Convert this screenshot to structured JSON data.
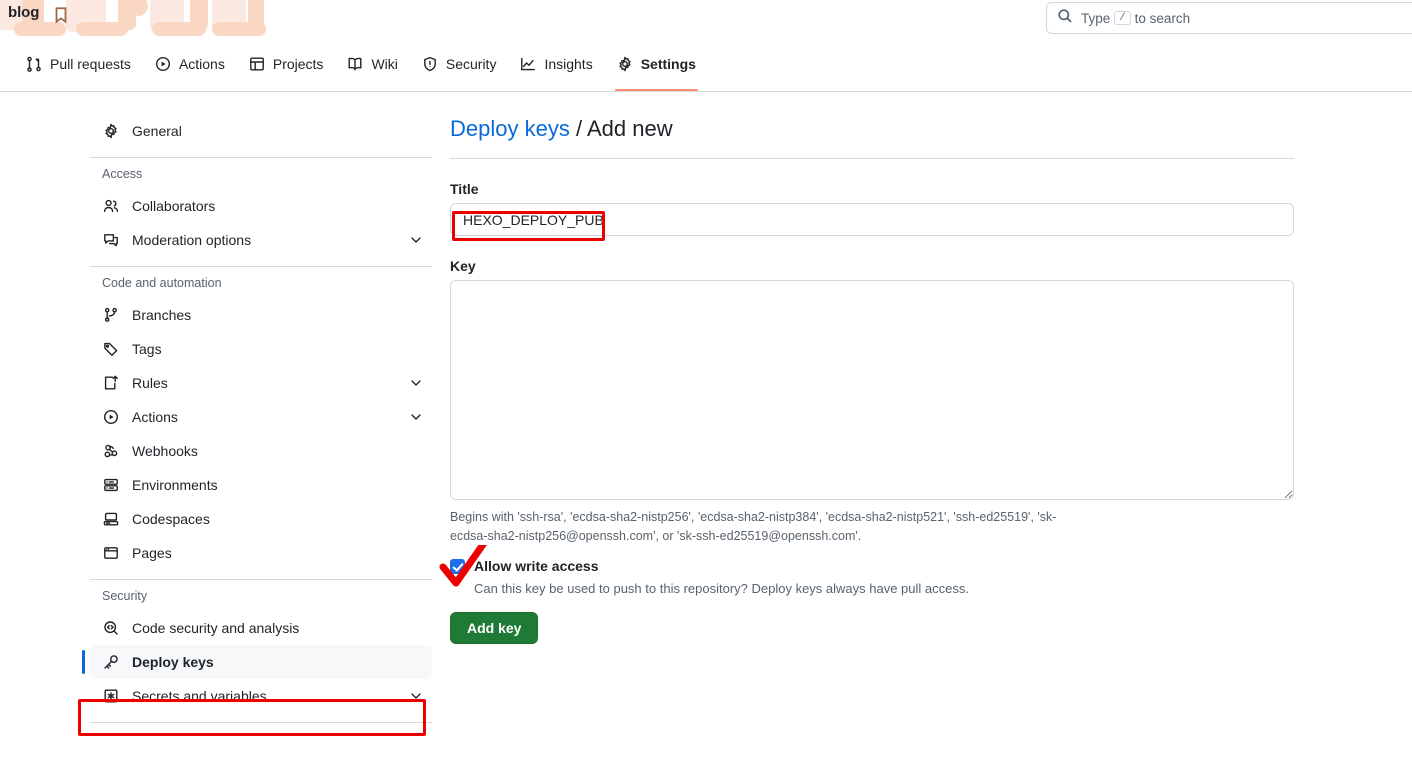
{
  "topbar": {
    "repo_name": "blog",
    "bookmark_icon": "bookmark-icon",
    "search_placeholder_prefix": "Type",
    "search_slash_key": "/",
    "search_placeholder_suffix": "to search",
    "search_icon": "search-icon"
  },
  "repo_nav": {
    "items": [
      {
        "label": "Pull requests",
        "icon": "git-pull-request-icon",
        "active": false
      },
      {
        "label": "Actions",
        "icon": "play-circle-icon",
        "active": false
      },
      {
        "label": "Projects",
        "icon": "table-icon",
        "active": false
      },
      {
        "label": "Wiki",
        "icon": "book-icon",
        "active": false
      },
      {
        "label": "Security",
        "icon": "shield-alert-icon",
        "active": false
      },
      {
        "label": "Insights",
        "icon": "graph-icon",
        "active": false
      },
      {
        "label": "Settings",
        "icon": "gear-icon",
        "active": true
      }
    ],
    "active_underline_color": "#fd8c73"
  },
  "sidebar": {
    "top_items": [
      {
        "label": "General",
        "icon": "gear-icon",
        "chevron": false,
        "selected": false
      }
    ],
    "groups": [
      {
        "title": "Access",
        "items": [
          {
            "label": "Collaborators",
            "icon": "people-icon",
            "chevron": false,
            "selected": false
          },
          {
            "label": "Moderation options",
            "icon": "comment-discussion-icon",
            "chevron": true,
            "selected": false
          }
        ]
      },
      {
        "title": "Code and automation",
        "items": [
          {
            "label": "Branches",
            "icon": "git-branch-icon",
            "chevron": false,
            "selected": false
          },
          {
            "label": "Tags",
            "icon": "tag-icon",
            "chevron": false,
            "selected": false
          },
          {
            "label": "Rules",
            "icon": "rules-icon",
            "chevron": true,
            "selected": false
          },
          {
            "label": "Actions",
            "icon": "play-circle-icon",
            "chevron": true,
            "selected": false
          },
          {
            "label": "Webhooks",
            "icon": "webhook-icon",
            "chevron": false,
            "selected": false
          },
          {
            "label": "Environments",
            "icon": "server-icon",
            "chevron": false,
            "selected": false
          },
          {
            "label": "Codespaces",
            "icon": "codespaces-icon",
            "chevron": false,
            "selected": false
          },
          {
            "label": "Pages",
            "icon": "browser-icon",
            "chevron": false,
            "selected": false
          }
        ]
      },
      {
        "title": "Security",
        "items": [
          {
            "label": "Code security and analysis",
            "icon": "code-scan-icon",
            "chevron": false,
            "selected": false
          },
          {
            "label": "Deploy keys",
            "icon": "key-icon",
            "chevron": false,
            "selected": true
          },
          {
            "label": "Secrets and variables",
            "icon": "asterisk-box-icon",
            "chevron": true,
            "selected": false
          }
        ]
      }
    ],
    "selected_accent_color": "#0969da"
  },
  "main": {
    "breadcrumb": {
      "link_label": "Deploy keys",
      "separator": "/",
      "current_label": "Add new"
    },
    "title_field": {
      "label": "Title",
      "value": "HEXO_DEPLOY_PUB",
      "placeholder": ""
    },
    "key_field": {
      "label": "Key",
      "value": "",
      "placeholder": "",
      "hint_line_1": "Begins with 'ssh-rsa', 'ecdsa-sha2-nistp256', 'ecdsa-sha2-nistp384', 'ecdsa-sha2-nistp521', 'ssh-ed25519',",
      "hint_line_2": "'sk-ecdsa-sha2-nistp256@openssh.com', or 'sk-ssh-ed25519@openssh.com'."
    },
    "allow_write": {
      "label": "Allow write access",
      "description": "Can this key be used to push to this repository? Deploy keys always have pull access.",
      "checked": true,
      "checkbox_color": "#1f6feb"
    },
    "submit_button": {
      "label": "Add key",
      "color": "#1f7a35"
    }
  },
  "annotations": {
    "color": "#ed0000",
    "title_rect": "red-rectangle-around-title-input",
    "deploy_keys_rect": "red-rectangle-around-deploy-keys-sidebar-item",
    "checkmark": "red-checkmark-over-allow-write-checkbox"
  }
}
